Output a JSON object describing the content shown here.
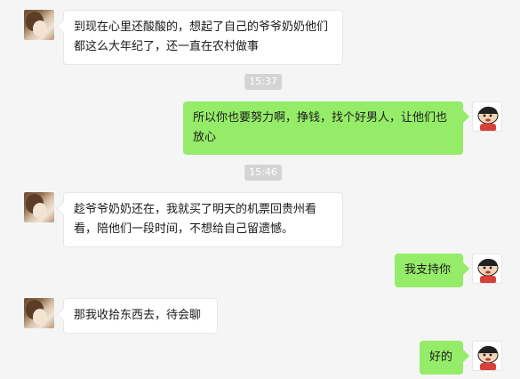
{
  "messages": [
    {
      "side": "left",
      "text": "到现在心里还酸酸的，想起了自己的爷爷奶奶他们都这么大年纪了，还一直在农村做事"
    },
    {
      "time": "15:37"
    },
    {
      "side": "right",
      "text": "所以你也要努力啊，挣钱，找个好男人，让他们也放心"
    },
    {
      "time": "15:46"
    },
    {
      "side": "left",
      "text": "趁爷爷奶奶还在，我就买了明天的机票回贵州看看，陪他们一段时间，不想给自己留遗憾。"
    },
    {
      "side": "right",
      "text": "我支持你"
    },
    {
      "side": "left",
      "text": "那我收拾东西去，待会聊"
    },
    {
      "side": "right",
      "text": "好的"
    }
  ],
  "icons": {
    "contact_avatar": "girl-photo-avatar",
    "self_avatar": "cartoon-kid-avatar"
  },
  "colors": {
    "background": "#f5f5f5",
    "incoming_bubble": "#ffffff",
    "outgoing_bubble": "#95ec69",
    "timestamp_bg": "#d4d4d4"
  }
}
